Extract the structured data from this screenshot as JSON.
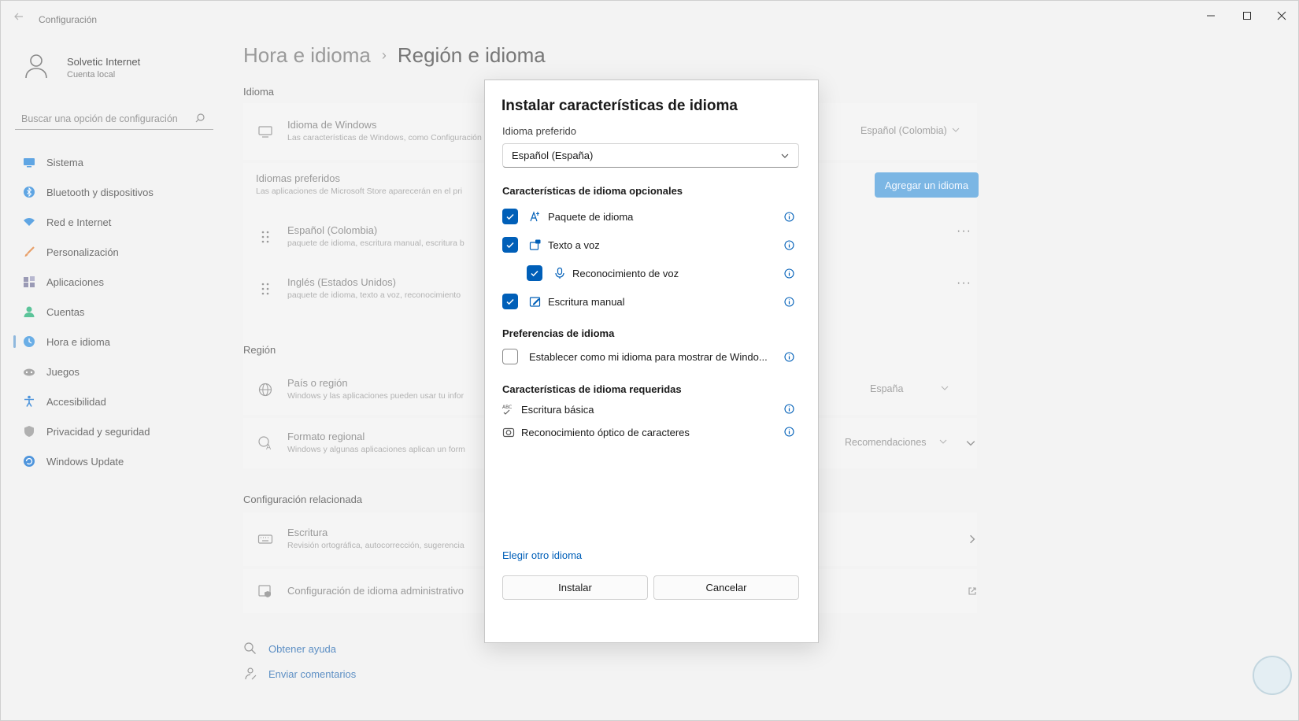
{
  "window": {
    "title": "Configuración"
  },
  "profile": {
    "name": "Solvetic Internet",
    "account": "Cuenta local"
  },
  "search": {
    "placeholder": "Buscar una opción de configuración"
  },
  "nav": [
    {
      "label": "Sistema",
      "icon": "monitor-icon",
      "color": "#3a86d8"
    },
    {
      "label": "Bluetooth y dispositivos",
      "icon": "bluetooth-icon",
      "color": "#3a86d8"
    },
    {
      "label": "Red e Internet",
      "icon": "wifi-icon",
      "color": "#3a86d8"
    },
    {
      "label": "Personalización",
      "icon": "brush-icon",
      "color": "#e0894a"
    },
    {
      "label": "Aplicaciones",
      "icon": "apps-icon",
      "color": "#7a7a9a"
    },
    {
      "label": "Cuentas",
      "icon": "person-icon",
      "color": "#2cab7a"
    },
    {
      "label": "Hora e idioma",
      "icon": "globe-clock-icon",
      "color": "#3a86d8"
    },
    {
      "label": "Juegos",
      "icon": "gamepad-icon",
      "color": "#8a8a8a"
    },
    {
      "label": "Accesibilidad",
      "icon": "accessibility-icon",
      "color": "#2a7ed6"
    },
    {
      "label": "Privacidad y seguridad",
      "icon": "shield-icon",
      "color": "#8a8a8a"
    },
    {
      "label": "Windows Update",
      "icon": "update-icon",
      "color": "#2a7ed6"
    }
  ],
  "breadcrumb": {
    "parent": "Hora e idioma",
    "separator": "›",
    "current": "Región e idioma"
  },
  "sections": {
    "idioma": "Idioma",
    "region": "Región",
    "related": "Configuración relacionada"
  },
  "rows": {
    "windows_lang": {
      "title": "Idioma de Windows",
      "sub": "Las características de Windows, como Configuración",
      "value": "Español (Colombia)"
    },
    "preferred": {
      "title": "Idiomas preferidos",
      "sub": "Las aplicaciones de Microsoft Store aparecerán en el pri",
      "button": "Agregar un idioma"
    },
    "lang1": {
      "title": "Español (Colombia)",
      "sub": "paquete de idioma, escritura manual, escritura b"
    },
    "lang2": {
      "title": "Inglés (Estados Unidos)",
      "sub": "paquete de idioma, texto a voz, reconocimiento"
    },
    "country": {
      "title": "País o región",
      "sub": "Windows y las aplicaciones pueden usar tu infor",
      "value": "España"
    },
    "format": {
      "title": "Formato regional",
      "sub": "Windows y algunas aplicaciones aplican un form",
      "value": "Recomendaciones"
    },
    "typing": {
      "title": "Escritura",
      "sub": "Revisión ortográfica, autocorrección, sugerencia"
    },
    "admin": {
      "title": "Configuración de idioma administrativo"
    }
  },
  "more_label": "···",
  "footer": {
    "help": "Obtener ayuda",
    "feedback": "Enviar comentarios"
  },
  "dialog": {
    "title": "Instalar características de idioma",
    "preferred_label": "Idioma preferido",
    "preferred_value": "Español (España)",
    "optional_header": "Características de idioma opcionales",
    "optional": [
      {
        "label": "Paquete de idioma",
        "checked": true,
        "icon": "language-pack-icon"
      },
      {
        "label": "Texto a voz",
        "checked": true,
        "icon": "text-to-speech-icon"
      },
      {
        "label": "Reconocimiento de voz",
        "checked": true,
        "icon": "microphone-icon"
      },
      {
        "label": "Escritura manual",
        "checked": true,
        "icon": "handwriting-icon"
      }
    ],
    "prefs_header": "Preferencias de idioma",
    "prefs_option": {
      "label": "Establecer como mi idioma para mostrar de Windo...",
      "checked": false
    },
    "required_header": "Características de idioma requeridas",
    "required": [
      {
        "label": "Escritura básica",
        "icon": "abc-icon"
      },
      {
        "label": "Reconocimiento óptico de caracteres",
        "icon": "camera-icon"
      }
    ],
    "other_link": "Elegir otro idioma",
    "install": "Instalar",
    "cancel": "Cancelar"
  },
  "colors": {
    "accent": "#005fb8",
    "accent_dimmed": "#7bb6e4",
    "link": "#5d8fc4"
  }
}
